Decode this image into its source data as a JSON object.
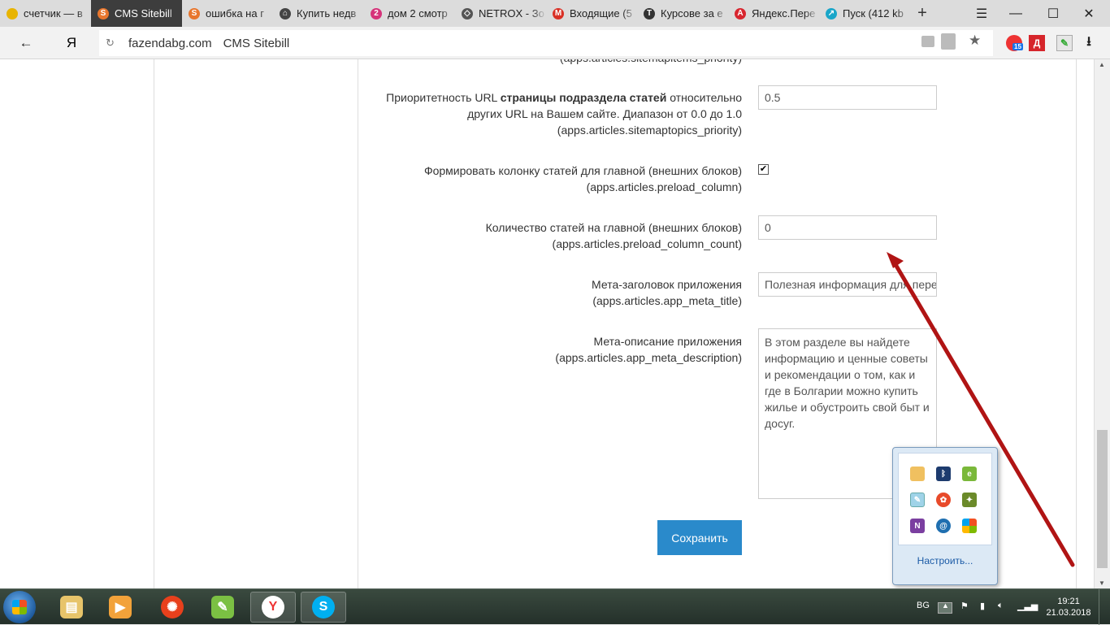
{
  "tabs": [
    {
      "label": "счетчик — в",
      "fav_color": "#e8b400",
      "fav_glyph": ""
    },
    {
      "label": "CMS Sitebill",
      "fav_color": "#e8762d",
      "fav_glyph": "S",
      "active": true
    },
    {
      "label": "ошибка на г",
      "fav_color": "#e8762d",
      "fav_glyph": "S"
    },
    {
      "label": "Купить недв",
      "fav_color": "#444444",
      "fav_glyph": "⌂"
    },
    {
      "label": "дом 2 смотр",
      "fav_color": "#d6337a",
      "fav_glyph": "2"
    },
    {
      "label": "NETROX - Зо",
      "fav_color": "#555555",
      "fav_glyph": "◇"
    },
    {
      "label": "Входящие (5",
      "fav_color": "#d93025",
      "fav_glyph": "M"
    },
    {
      "label": "Курсове за е",
      "fav_color": "#333333",
      "fav_glyph": "T"
    },
    {
      "label": "Яндекс.Пере",
      "fav_color": "#d8262f",
      "fav_glyph": "A"
    },
    {
      "label": "Пуск (412 kb",
      "fav_color": "#1aa6c9",
      "fav_glyph": "↗"
    }
  ],
  "browser": {
    "yandex_logo": "Я",
    "host": "fazendabg.com",
    "page_title": "CMS Sitebill",
    "badge_count": "15",
    "ext_letter": "Д"
  },
  "form": {
    "top_partial_key": "(apps.articles.sitemapitems_priority)",
    "topics_priority": {
      "line1_pre": "Приоритетность URL ",
      "line1_bold": "страницы подраздела статей",
      "line1_post": " относительно",
      "line2": "других URL на Вашем сайте. Диапазон от 0.0 до 1.0",
      "key": "(apps.articles.sitemaptopics_priority)",
      "value": "0.5"
    },
    "preload_column": {
      "label": "Формировать колонку статей для главной (внешних блоков)",
      "key": "(apps.articles.preload_column)",
      "checked_mark": "✔"
    },
    "preload_count": {
      "label": "Количество статей на главной (внешних блоков)",
      "key": "(apps.articles.preload_column_count)",
      "value": "0"
    },
    "meta_title": {
      "label": "Мета-заголовок приложения",
      "key": "(apps.articles.app_meta_title)",
      "value": "Полезная информация для переезда"
    },
    "meta_description": {
      "label": "Мета-описание приложения",
      "key": "(apps.articles.app_meta_description)",
      "value": "В этом разделе вы найдете информацию и ценные советы и рекомендации о том, как и где в Болгарии можно купить жилье и обустроить свой быт и досуг."
    },
    "save_label": "Сохранить"
  },
  "tray_popup": {
    "customize_label": "Настроить...",
    "icons": [
      "pill-icon",
      "bluetooth-icon",
      "evernote-icon",
      "notepad-icon",
      "flower-icon",
      "bird-icon",
      "onenote-icon",
      "update-icon",
      "windows-flag-icon"
    ]
  },
  "taskbar": {
    "lang": "BG",
    "time": "19:21",
    "date": "21.03.2018"
  },
  "colors": {
    "accent_button": "#2a8acb",
    "arrow": "#b01414"
  }
}
